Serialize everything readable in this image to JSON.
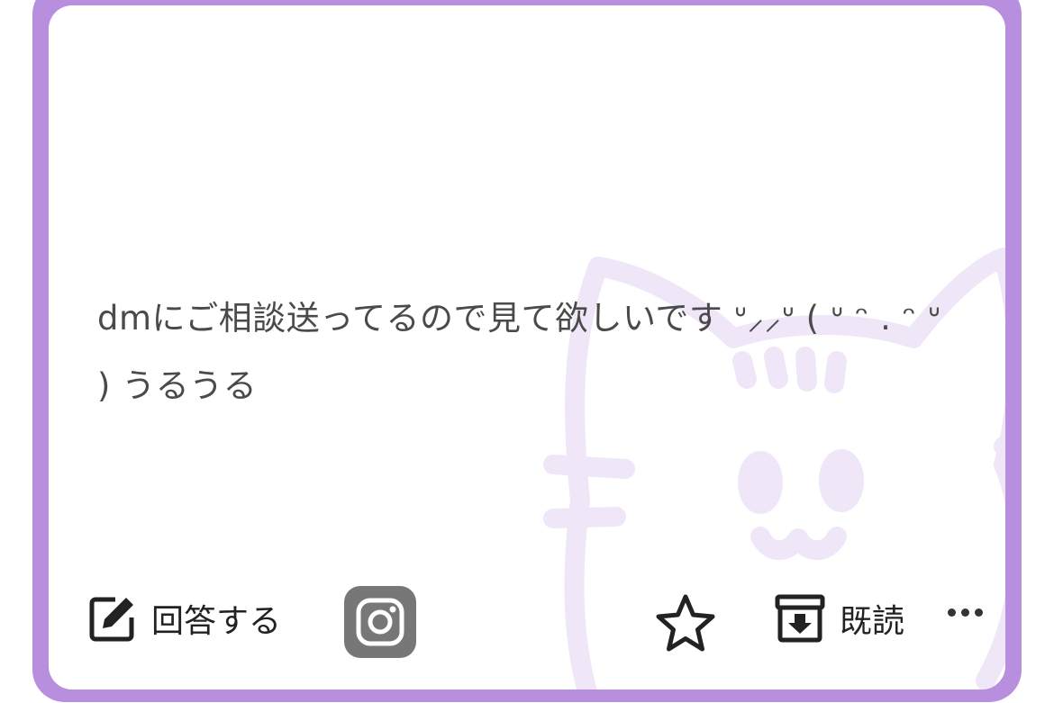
{
  "question": {
    "text": "dmにご相談送ってるので見て欲しいです ᐡ⸝⸝ᐡ ( ᐡ ᵔ . ᵔ ᐡ ) うるうる"
  },
  "actions": {
    "answer_label": "回答する",
    "read_label": "既読"
  },
  "icons": {
    "answer": "edit-icon",
    "instagram": "instagram-icon",
    "favorite": "star-icon",
    "read": "archive-download-icon",
    "more": "more-horizontal-icon",
    "background": "cat-face-doodle"
  },
  "colors": {
    "frame": "#b88fdf",
    "card": "#ffffff",
    "cat_doodle": "#efe6f8",
    "text": "#4a4a4a",
    "icon": "#222222",
    "instagram_box": "#777777"
  }
}
